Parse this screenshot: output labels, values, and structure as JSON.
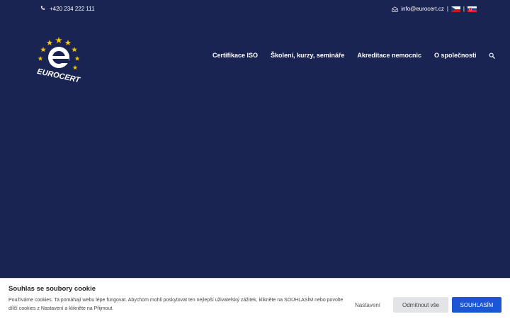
{
  "topbar": {
    "phone": "+420 234 222 111",
    "email": "info@eurocert.cz",
    "separator": "|"
  },
  "logo": {
    "wordmark": "EUROCERT",
    "letter": "e"
  },
  "nav": {
    "items": [
      {
        "label": "Certifikace ISO"
      },
      {
        "label": "Školení, kurzy, semináře"
      },
      {
        "label": "Akreditace nemocnic"
      },
      {
        "label": "O společnosti"
      }
    ],
    "search_icon": "search-icon"
  },
  "cookie": {
    "title": "Souhlas se soubory cookie",
    "text": "Používáme cookies. Ta pomáhají webu lépe fungovat. Abychom mohli poskytovat ten nejlepší uživatelský zážitek, klikněte na SOUHLASÍM nebo povolte dílčí cookies z Nastavení a klikněte na Přijmout.",
    "settings_label": "Nastavení",
    "reject_label": "Odmítnout vše",
    "accept_label": "SOUHLASÍM"
  },
  "colors": {
    "background": "#1a2452",
    "accent_blue": "#1a56d6",
    "star_yellow": "#f5c400"
  }
}
